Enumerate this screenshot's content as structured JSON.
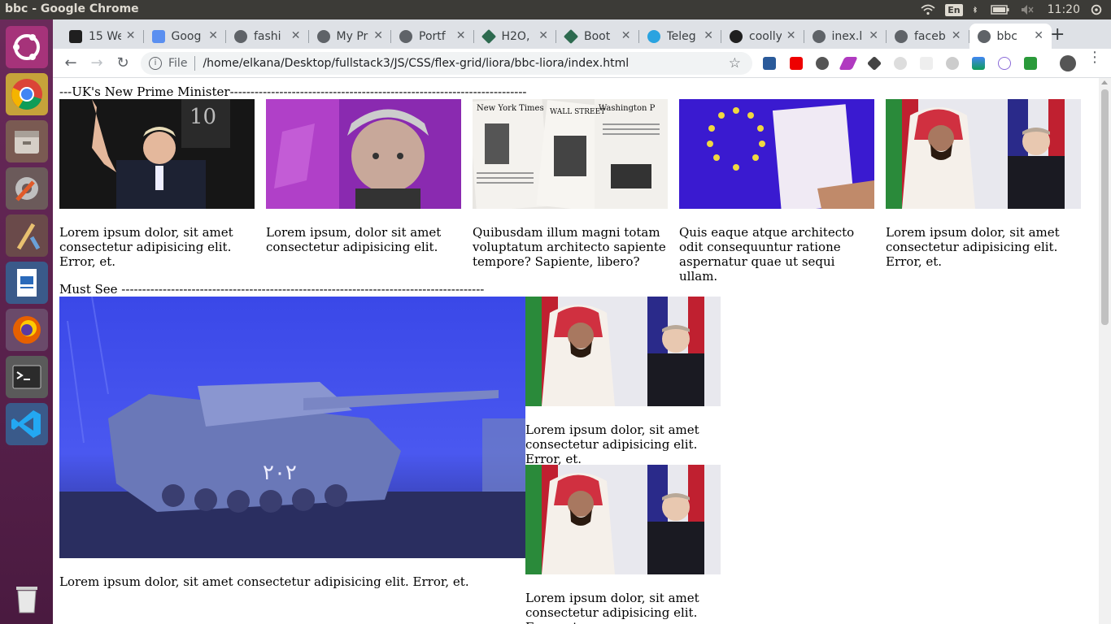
{
  "os": {
    "window_title": "bbc - Google Chrome",
    "keyboard_layout": "En",
    "clock": "11:20"
  },
  "browser": {
    "tabs": [
      {
        "label": "15 We",
        "favicon": "app-icon",
        "color": "#1f1f1f"
      },
      {
        "label": "Goog",
        "favicon": "google-translate-icon",
        "color": "#5a8ff0"
      },
      {
        "label": "fashi",
        "favicon": "globe-icon",
        "color": "#5f6368"
      },
      {
        "label": "My Pr",
        "favicon": "globe-icon",
        "color": "#5f6368"
      },
      {
        "label": "Portf",
        "favicon": "globe-icon",
        "color": "#5f6368"
      },
      {
        "label": "H2O, ",
        "favicon": "diamond-icon",
        "color": "#2d6a4f"
      },
      {
        "label": "Boot",
        "favicon": "diamond-icon",
        "color": "#2d6a4f"
      },
      {
        "label": "Teleg",
        "favicon": "telegram-icon",
        "color": "#2aa3e0"
      },
      {
        "label": "coolly",
        "favicon": "github-icon",
        "color": "#1f1f1f"
      },
      {
        "label": "inex.l",
        "favicon": "globe-icon",
        "color": "#5f6368"
      },
      {
        "label": "faceb",
        "favicon": "globe-icon",
        "color": "#5f6368"
      },
      {
        "label": "bbc",
        "favicon": "globe-icon",
        "color": "#5f6368",
        "active": true
      }
    ],
    "address": {
      "scheme_label": "File",
      "url": "/home/elkana/Desktop/fullstack3/JS/CSS/flex-grid/liora/bbc-liora/index.html"
    }
  },
  "page": {
    "section1": {
      "heading": "---UK's New Prime Minister------------------------------------------------------------------------",
      "cards": [
        {
          "image": "boris-waving-photo",
          "caption": "Lorem ipsum dolor, sit amet consectetur adipisicing elit. Error, et."
        },
        {
          "image": "boris-portrait-photo",
          "caption": "Lorem ipsum, dolor sit amet consectetur adipisicing elit."
        },
        {
          "image": "newspapers-photo",
          "caption": "Quibusdam illum magni totam voluptatum architecto sapiente tempore? Sapiente, libero?"
        },
        {
          "image": "eu-document-photo",
          "caption": "Quis eaque atque architecto odit consequuntur ratione aspernatur quae ut sequi ullam."
        },
        {
          "image": "leaders-handshake-photo",
          "caption": "Lorem ipsum dolor, sit amet consectetur adipisicing elit. Error, et."
        }
      ]
    },
    "section2": {
      "heading": "Must See ----------------------------------------------------------------------------------------",
      "feature": {
        "image": "underwater-tank-photo",
        "caption": "Lorem ipsum dolor, sit amet consectetur adipisicing elit. Error, et."
      },
      "side": [
        {
          "image": "leaders-handshake-photo",
          "caption": "Lorem ipsum dolor, sit amet consectetur adipisicing elit. Error, et."
        },
        {
          "image": "leaders-handshake-photo",
          "caption": "Lorem ipsum dolor, sit amet consectetur adipisicing elit. Error, et."
        }
      ]
    }
  }
}
